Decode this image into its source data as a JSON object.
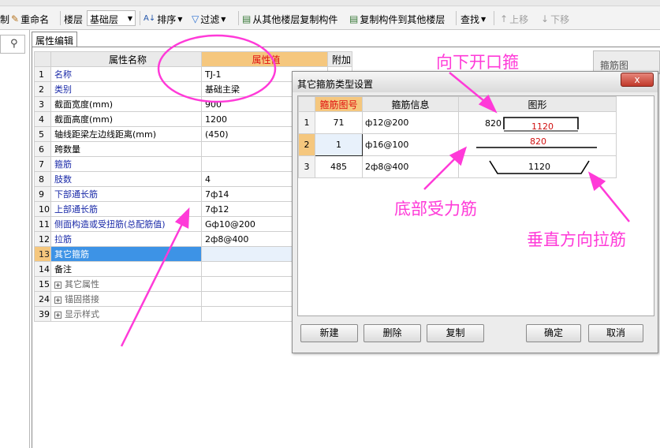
{
  "toolbar": {
    "partial_left": "制",
    "rename": "重命名",
    "floor_label": "楼层",
    "floor_value": "基础层",
    "sort": "排序",
    "filter": "过滤",
    "copy_from": "从其他楼层复制构件",
    "copy_to": "复制构件到其他楼层",
    "find": "查找",
    "move_up": "上移",
    "move_down": "下移"
  },
  "property_editor": {
    "tab": "属性编辑",
    "headers": {
      "name": "属性名称",
      "value": "属性值",
      "extra": "附加"
    },
    "rows": [
      {
        "num": "1",
        "name": "名称",
        "value": "TJ-1"
      },
      {
        "num": "2",
        "name": "类别",
        "value": "基础主梁"
      },
      {
        "num": "3",
        "name": "截面宽度(mm)",
        "value": "900"
      },
      {
        "num": "4",
        "name": "截面高度(mm)",
        "value": "1200"
      },
      {
        "num": "5",
        "name": "轴线距梁左边线距离(mm)",
        "value": "(450)"
      },
      {
        "num": "6",
        "name": "跨数量",
        "value": ""
      },
      {
        "num": "7",
        "name": "箍筋",
        "value": ""
      },
      {
        "num": "8",
        "name": "肢数",
        "value": "4"
      },
      {
        "num": "9",
        "name": "下部通长筋",
        "value": "7ф14"
      },
      {
        "num": "10",
        "name": "上部通长筋",
        "value": "7ф12"
      },
      {
        "num": "11",
        "name": "侧面构造或受扭筋(总配筋值)",
        "value": "Gф10@200"
      },
      {
        "num": "12",
        "name": "拉筋",
        "value": "2ф8@400"
      },
      {
        "num": "13",
        "name": "其它箍筋",
        "value": ""
      },
      {
        "num": "14",
        "name": "备注",
        "value": ""
      },
      {
        "num": "15",
        "name": "其它属性",
        "value": ""
      },
      {
        "num": "24",
        "name": "锚固搭接",
        "value": ""
      },
      {
        "num": "39",
        "name": "显示样式",
        "value": ""
      }
    ]
  },
  "right_panel": {
    "title": "箍筋图"
  },
  "dialog": {
    "title": "其它箍筋类型设置",
    "close": "x",
    "headers": {
      "num": "箍筋图号",
      "info": "箍筋信息",
      "shape": "图形"
    },
    "rows": [
      {
        "row": "1",
        "num": "71",
        "info": "ф12@200",
        "dim1": "820",
        "dim2": "1120"
      },
      {
        "row": "2",
        "num": "1",
        "info": "ф16@100",
        "dim1": "820"
      },
      {
        "row": "3",
        "num": "485",
        "info": "2ф8@400",
        "dim1": "1120"
      }
    ],
    "buttons": {
      "new": "新建",
      "delete": "删除",
      "copy": "复制",
      "ok": "确定",
      "cancel": "取消"
    }
  },
  "annotations": {
    "top": "向下开口箍",
    "bottom_bar": "底部受力筋",
    "vertical_tie": "垂直方向拉筋"
  },
  "colors": {
    "annotation": "#ff3ad8",
    "header_highlight": "#f5c77e",
    "selection": "#3d93e6"
  }
}
